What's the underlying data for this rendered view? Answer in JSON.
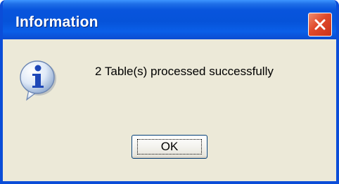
{
  "dialog": {
    "title": "Information",
    "message": "2 Table(s) processed successfully",
    "ok_label": "OK",
    "icon": "information-icon",
    "close_icon": "close-icon"
  },
  "colors": {
    "title_bar": "#0653d9",
    "frame": "#0b4dd8",
    "body_background": "#ece9d8",
    "close_button": "#e0492a",
    "button_border": "#003c74"
  }
}
